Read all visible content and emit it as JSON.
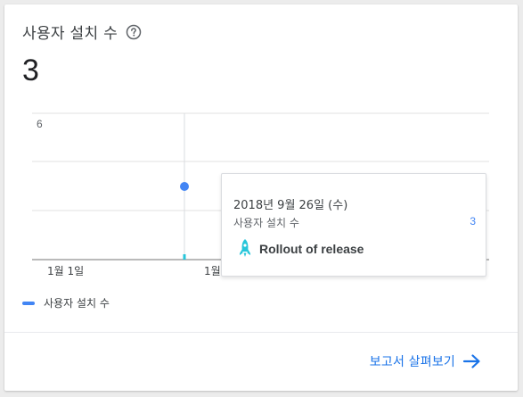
{
  "card": {
    "title": "사용자 설치 수",
    "value": "3"
  },
  "chart_data": {
    "type": "line",
    "series": [
      {
        "name": "사용자 설치 수",
        "color": "#4285f4",
        "points": [
          {
            "x": "2018-09-26",
            "y": 3
          }
        ]
      }
    ],
    "y_tick_labels": [
      "6"
    ],
    "ylim": [
      0,
      6
    ],
    "x_tick_labels": [
      "1월 1일",
      "1월"
    ],
    "grid": true,
    "legend": "bottom-left"
  },
  "tooltip": {
    "date": "2018년 9월 26일 (수)",
    "metric_label": "사용자 설치 수",
    "metric_value": "3",
    "annotation_label": "Rollout of release",
    "annotation_icon": "rocket-icon",
    "annotation_color": "#26c6da"
  },
  "legend": {
    "label": "사용자 설치 수",
    "color": "#4285f4"
  },
  "footer": {
    "link_label": "보고서 살펴보기",
    "link_color": "#1a73e8"
  }
}
